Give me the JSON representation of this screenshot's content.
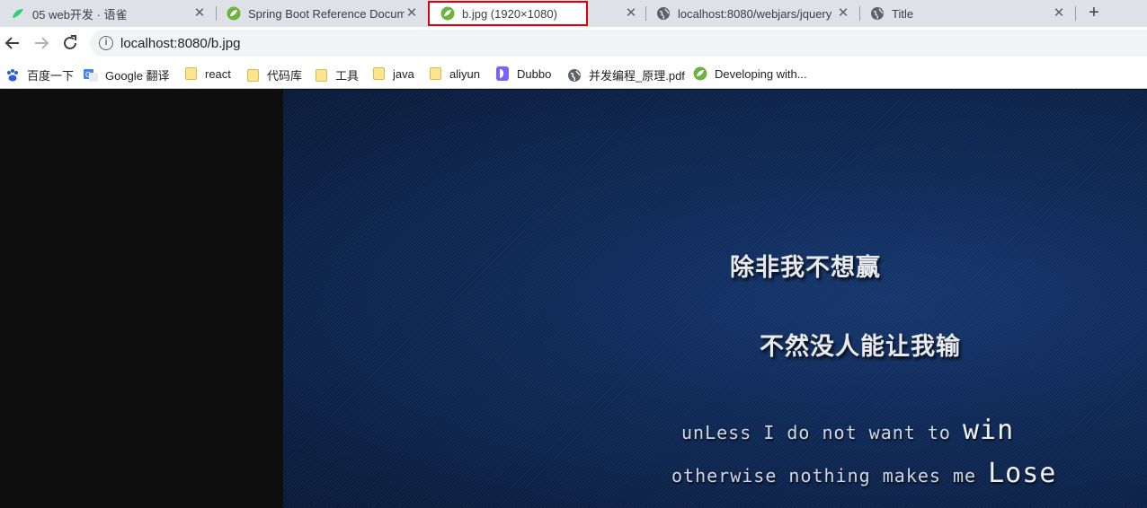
{
  "tabs": [
    {
      "title": "05 web开发 · 语雀",
      "icon": "yuque-icon"
    },
    {
      "title": "Spring Boot Reference Docum",
      "icon": "spring-icon"
    },
    {
      "title": "b.jpg (1920×1080)",
      "icon": "spring-icon",
      "active": true
    },
    {
      "title": "localhost:8080/webjars/jquery",
      "icon": "globe-icon"
    },
    {
      "title": "Title",
      "icon": "globe-icon"
    }
  ],
  "toolbar": {
    "url": "localhost:8080/b.jpg"
  },
  "bookmarks": [
    {
      "label": "百度一下",
      "icon": "baidu-icon"
    },
    {
      "label": "Google 翻译",
      "icon": "google-translate-icon"
    },
    {
      "label": "react",
      "icon": "folder-icon"
    },
    {
      "label": "代码库",
      "icon": "folder-icon"
    },
    {
      "label": "工具",
      "icon": "folder-icon"
    },
    {
      "label": "java",
      "icon": "folder-icon"
    },
    {
      "label": "aliyun",
      "icon": "folder-icon"
    },
    {
      "label": "Dubbo",
      "icon": "dubbo-icon"
    },
    {
      "label": "并发编程_原理.pdf",
      "icon": "globe-icon"
    },
    {
      "label": "Developing with...",
      "icon": "spring-icon"
    }
  ],
  "image": {
    "line1": "除非我不想赢",
    "line2": "不然没人能让我输",
    "line3a": "unLess I do not want to",
    "line3b": "win",
    "line4a": "otherwise nothing makes me",
    "line4b": "Lose"
  },
  "colors": {
    "active_tab_highlight": "#e0000a",
    "wallpaper": "#0f2956"
  }
}
